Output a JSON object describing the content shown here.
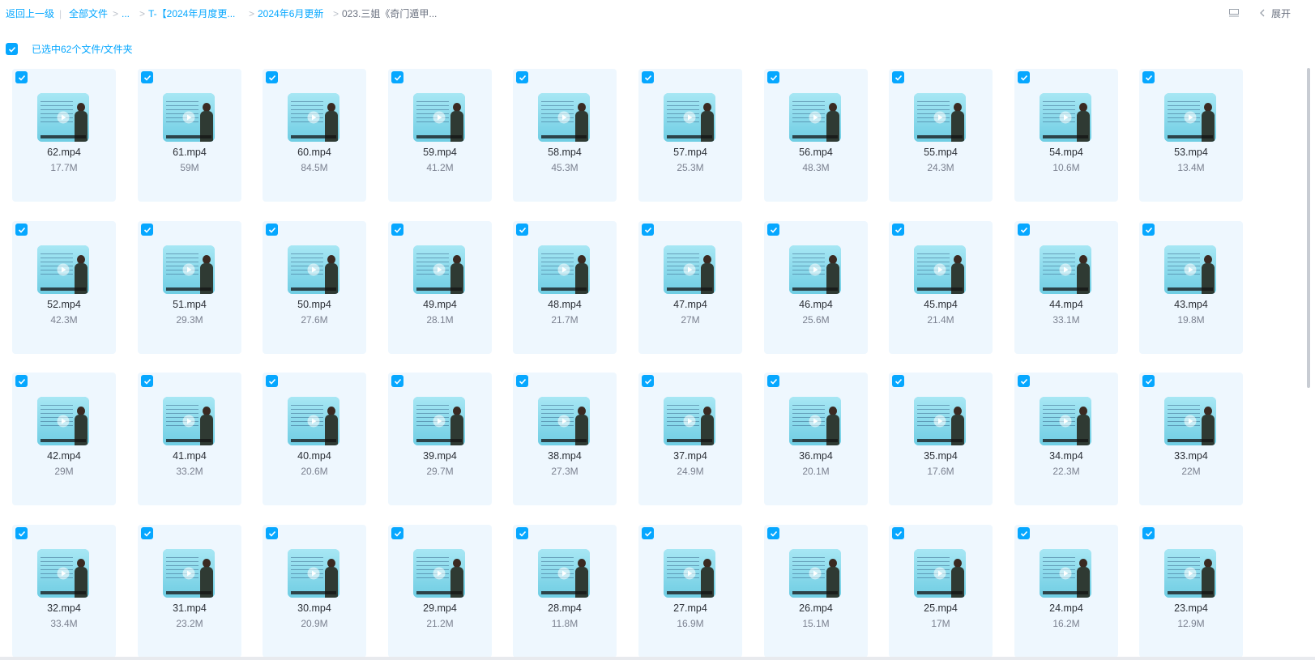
{
  "breadcrumb": {
    "back": "返回上一级",
    "separator": "|",
    "root": "全部文件",
    "chev": ">",
    "ellipsis": "...",
    "folder1": "T-【2024年月度更...",
    "folder2": "2024年6月更新",
    "current": "023.三姐《奇门遁甲..."
  },
  "toolbar": {
    "view_icon": "list-view-icon",
    "collapse_icon": "chevron-left-icon",
    "expand_label": "展开"
  },
  "selection": {
    "label": "已选中62个文件/文件夹",
    "checked": true
  },
  "colors": {
    "accent": "#06a7ff",
    "card_bg": "#eef7fe"
  },
  "files": [
    {
      "name": "62.mp4",
      "size": "17.7M"
    },
    {
      "name": "61.mp4",
      "size": "59M"
    },
    {
      "name": "60.mp4",
      "size": "84.5M"
    },
    {
      "name": "59.mp4",
      "size": "41.2M"
    },
    {
      "name": "58.mp4",
      "size": "45.3M"
    },
    {
      "name": "57.mp4",
      "size": "25.3M"
    },
    {
      "name": "56.mp4",
      "size": "48.3M"
    },
    {
      "name": "55.mp4",
      "size": "24.3M"
    },
    {
      "name": "54.mp4",
      "size": "10.6M"
    },
    {
      "name": "53.mp4",
      "size": "13.4M"
    },
    {
      "name": "52.mp4",
      "size": "42.3M"
    },
    {
      "name": "51.mp4",
      "size": "29.3M"
    },
    {
      "name": "50.mp4",
      "size": "27.6M"
    },
    {
      "name": "49.mp4",
      "size": "28.1M"
    },
    {
      "name": "48.mp4",
      "size": "21.7M"
    },
    {
      "name": "47.mp4",
      "size": "27M"
    },
    {
      "name": "46.mp4",
      "size": "25.6M"
    },
    {
      "name": "45.mp4",
      "size": "21.4M"
    },
    {
      "name": "44.mp4",
      "size": "33.1M"
    },
    {
      "name": "43.mp4",
      "size": "19.8M"
    },
    {
      "name": "42.mp4",
      "size": "29M"
    },
    {
      "name": "41.mp4",
      "size": "33.2M"
    },
    {
      "name": "40.mp4",
      "size": "20.6M"
    },
    {
      "name": "39.mp4",
      "size": "29.7M"
    },
    {
      "name": "38.mp4",
      "size": "27.3M"
    },
    {
      "name": "37.mp4",
      "size": "24.9M"
    },
    {
      "name": "36.mp4",
      "size": "20.1M"
    },
    {
      "name": "35.mp4",
      "size": "17.6M"
    },
    {
      "name": "34.mp4",
      "size": "22.3M"
    },
    {
      "name": "33.mp4",
      "size": "22M"
    },
    {
      "name": "32.mp4",
      "size": "33.4M"
    },
    {
      "name": "31.mp4",
      "size": "23.2M"
    },
    {
      "name": "30.mp4",
      "size": "20.9M"
    },
    {
      "name": "29.mp4",
      "size": "21.2M"
    },
    {
      "name": "28.mp4",
      "size": "11.8M"
    },
    {
      "name": "27.mp4",
      "size": "16.9M"
    },
    {
      "name": "26.mp4",
      "size": "15.1M"
    },
    {
      "name": "25.mp4",
      "size": "17M"
    },
    {
      "name": "24.mp4",
      "size": "16.2M"
    },
    {
      "name": "23.mp4",
      "size": "12.9M"
    }
  ]
}
